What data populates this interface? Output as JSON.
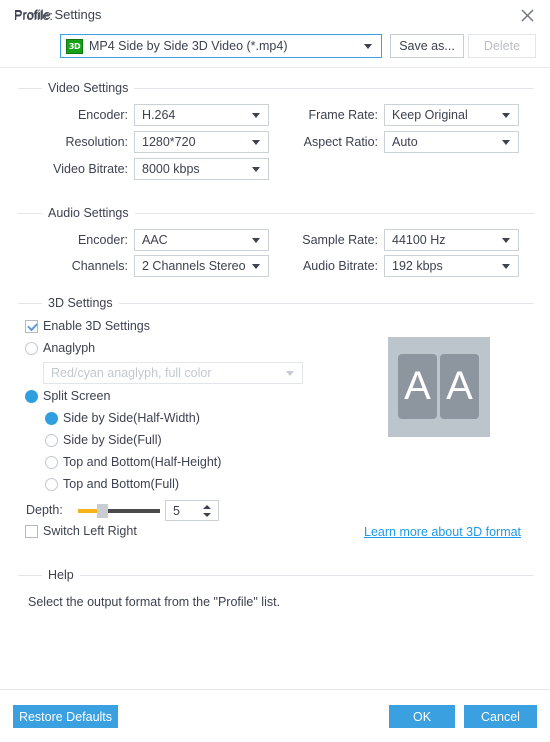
{
  "window": {
    "title": "Profile Settings",
    "close_icon": "close-icon"
  },
  "profile": {
    "label": "Profile:",
    "icon_text": "3D",
    "value": "MP4 Side by Side 3D Video (*.mp4)",
    "save_as_label": "Save as...",
    "delete_label": "Delete"
  },
  "video_settings": {
    "title": "Video Settings",
    "encoder_label": "Encoder:",
    "encoder_value": "H.264",
    "resolution_label": "Resolution:",
    "resolution_value": "1280*720",
    "video_bitrate_label": "Video Bitrate:",
    "video_bitrate_value": "8000 kbps",
    "frame_rate_label": "Frame Rate:",
    "frame_rate_value": "Keep Original",
    "aspect_ratio_label": "Aspect Ratio:",
    "aspect_ratio_value": "Auto"
  },
  "audio_settings": {
    "title": "Audio Settings",
    "encoder_label": "Encoder:",
    "encoder_value": "AAC",
    "channels_label": "Channels:",
    "channels_value": "2 Channels Stereo",
    "sample_rate_label": "Sample Rate:",
    "sample_rate_value": "44100 Hz",
    "audio_bitrate_label": "Audio Bitrate:",
    "audio_bitrate_value": "192 kbps"
  },
  "three_d_settings": {
    "title": "3D Settings",
    "enable_label": "Enable 3D Settings",
    "anaglyph_label": "Anaglyph",
    "anaglyph_value": "Red/cyan anaglyph, full color",
    "split_screen_label": "Split Screen",
    "split_options": [
      "Side by Side(Half-Width)",
      "Side by Side(Full)",
      "Top and Bottom(Half-Height)",
      "Top and Bottom(Full)"
    ],
    "depth_label": "Depth:",
    "depth_value": "5",
    "switch_left_right_label": "Switch Left Right",
    "learn_more_label": "Learn more about 3D format",
    "preview_letter_left": "A",
    "preview_letter_right": "A"
  },
  "help": {
    "title": "Help",
    "text": "Select the output format from the \"Profile\" list."
  },
  "footer": {
    "restore_label": "Restore Defaults",
    "ok_label": "OK",
    "cancel_label": "Cancel"
  },
  "colors": {
    "accent": "#3aa0e0",
    "link": "#1e9ae8",
    "slider_fill": "#f5b317",
    "icon_green": "#18a018"
  }
}
